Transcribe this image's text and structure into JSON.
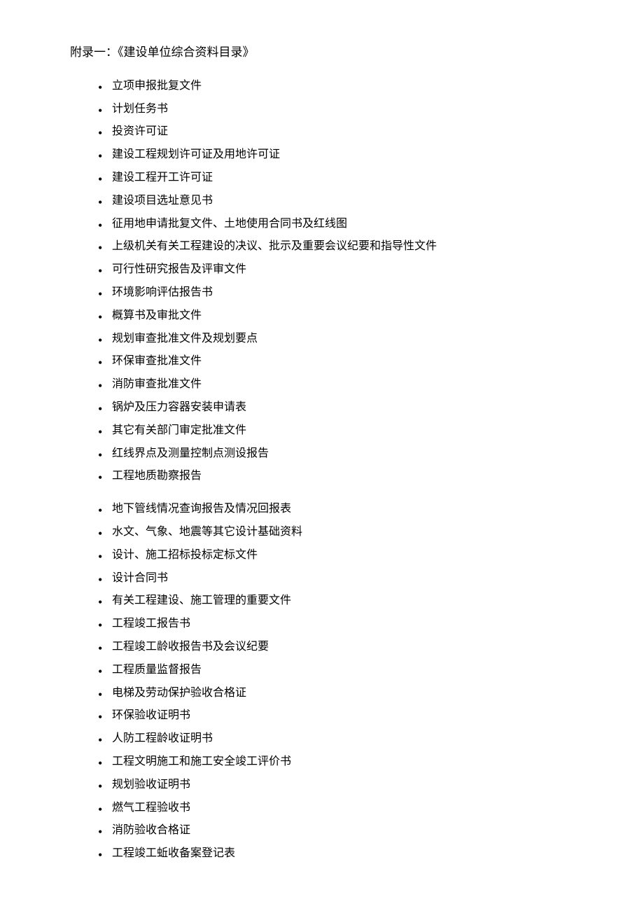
{
  "header": {
    "title": "附录一：《建设单位综合资料目录》"
  },
  "items_group1": [
    "立项申报批复文件",
    "计划任务书",
    "投资许可证",
    "建设工程规划许可证及用地许可证",
    "建设工程开工许可证",
    "建设项目选址意见书",
    "征用地申请批复文件、土地使用合同书及红线图",
    "上级机关有关工程建设的决议、批示及重要会议纪要和指导性文件",
    "可行性研究报告及评审文件",
    "环境影响评估报告书",
    "概算书及审批文件",
    "规划审查批准文件及规划要点",
    "环保审查批准文件",
    "消防审查批准文件",
    "锅炉及压力容器安装申请表",
    "其它有关部门审定批准文件",
    "红线界点及测量控制点测设报告",
    "工程地质勘察报告"
  ],
  "items_group2": [
    "地下管线情况查询报告及情况回报表",
    "水文、气象、地震等其它设计基础资料",
    "设计、施工招标投标定标文件",
    "设计合同书",
    "有关工程建设、施工管理的重要文件",
    "工程竣工报告书",
    "工程竣工龄收报告书及会议纪要",
    "工程质量监督报告",
    "电梯及劳动保护验收合格证",
    "环保验收证明书",
    "人防工程龄收证明书",
    "工程文明施工和施工安全竣工评价书",
    "规划验收证明书",
    "燃气工程验收书",
    "消防验收合格证",
    "工程竣工蚯收备案登记表"
  ]
}
